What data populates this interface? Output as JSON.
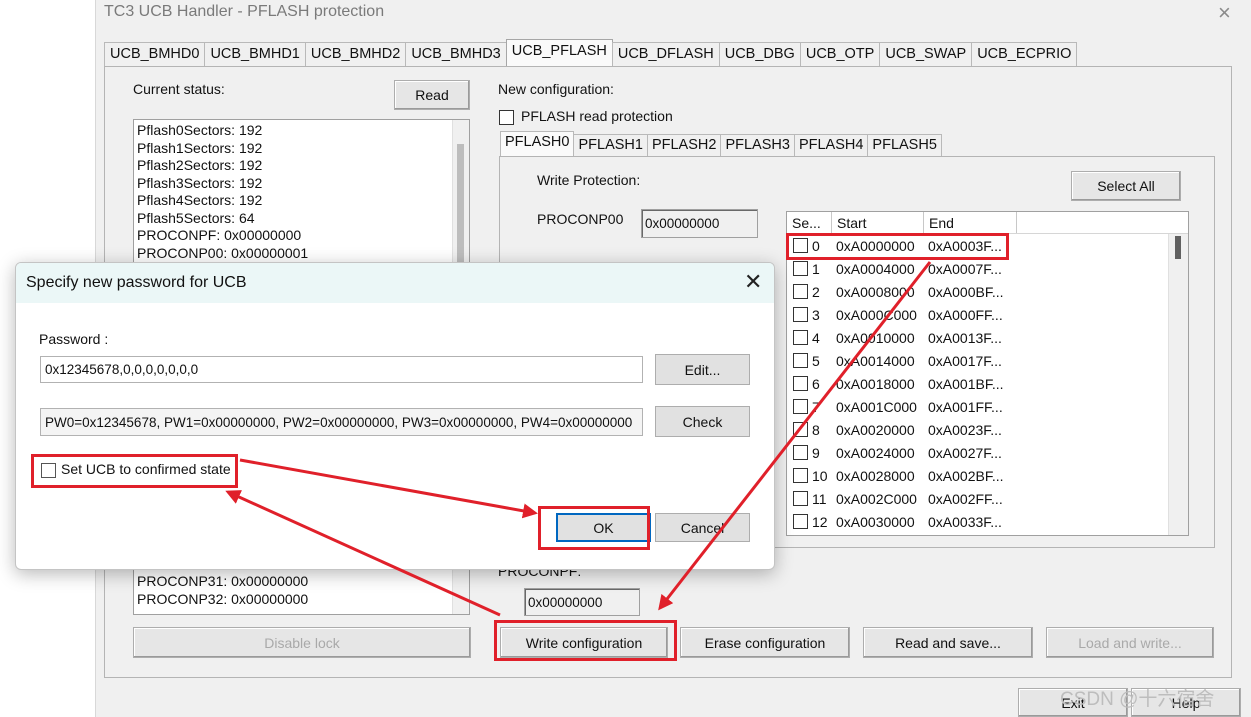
{
  "window": {
    "title": "TC3 UCB Handler - PFLASH protection",
    "close_glyph": "×"
  },
  "tabs": [
    "UCB_BMHD0",
    "UCB_BMHD1",
    "UCB_BMHD2",
    "UCB_BMHD3",
    "UCB_PFLASH",
    "UCB_DFLASH",
    "UCB_DBG",
    "UCB_OTP",
    "UCB_SWAP",
    "UCB_ECPRIO"
  ],
  "selected_tab": "UCB_PFLASH",
  "current_status": {
    "label": "Current status:",
    "read_button": "Read",
    "lines_top": [
      "Pflash0Sectors: 192",
      "Pflash1Sectors: 192",
      "Pflash2Sectors: 192",
      "Pflash3Sectors: 192",
      "Pflash4Sectors: 192",
      "Pflash5Sectors: 64",
      "PROCONPF: 0x00000000",
      "PROCONP00: 0x00000001"
    ],
    "lines_bottom": [
      "PROCONP31: 0x00000000",
      "PROCONP32: 0x00000000"
    ],
    "disable_lock_button": "Disable lock"
  },
  "new_config": {
    "label": "New configuration:",
    "read_protection_label": "PFLASH read protection",
    "read_protection_checked": false,
    "subtabs": [
      "PFLASH0",
      "PFLASH1",
      "PFLASH2",
      "PFLASH3",
      "PFLASH4",
      "PFLASH5"
    ],
    "selected_subtab": "PFLASH0",
    "write_protection_label": "Write Protection:",
    "select_all_button": "Select All",
    "proconp00_label": "PROCONP00",
    "proconp00_value": "0x00000000",
    "proconpf_label": "PROCONPF:",
    "proconpf_value": "0x00000000",
    "columns": [
      "Se...",
      "Start",
      "End"
    ],
    "sectors": [
      {
        "num": "0",
        "start": "0xA0000000",
        "end": "0xA0003F..."
      },
      {
        "num": "1",
        "start": "0xA0004000",
        "end": "0xA0007F..."
      },
      {
        "num": "2",
        "start": "0xA0008000",
        "end": "0xA000BF..."
      },
      {
        "num": "3",
        "start": "0xA000C000",
        "end": "0xA000FF..."
      },
      {
        "num": "4",
        "start": "0xA0010000",
        "end": "0xA0013F..."
      },
      {
        "num": "5",
        "start": "0xA0014000",
        "end": "0xA0017F..."
      },
      {
        "num": "6",
        "start": "0xA0018000",
        "end": "0xA001BF..."
      },
      {
        "num": "7",
        "start": "0xA001C000",
        "end": "0xA001FF..."
      },
      {
        "num": "8",
        "start": "0xA0020000",
        "end": "0xA0023F..."
      },
      {
        "num": "9",
        "start": "0xA0024000",
        "end": "0xA0027F..."
      },
      {
        "num": "10",
        "start": "0xA0028000",
        "end": "0xA002BF..."
      },
      {
        "num": "11",
        "start": "0xA002C000",
        "end": "0xA002FF..."
      },
      {
        "num": "12",
        "start": "0xA0030000",
        "end": "0xA0033F..."
      }
    ]
  },
  "bottom_buttons": {
    "write_config": "Write configuration",
    "erase_config": "Erase configuration",
    "read_and_save": "Read and save...",
    "load_and_write": "Load and write...",
    "exit": "Exit",
    "help": "Help"
  },
  "dialog": {
    "title": "Specify new password for UCB",
    "close_glyph": "✕",
    "password_label": "Password :",
    "password_value": "0x12345678,0,0,0,0,0,0,0",
    "edit_button": "Edit...",
    "summary_value": "PW0=0x12345678, PW1=0x00000000, PW2=0x00000000, PW3=0x00000000, PW4=0x00000000",
    "check_button": "Check",
    "confirmed_label": "Set UCB to confirmed state",
    "confirmed_checked": false,
    "ok_button": "OK",
    "cancel_button": "Cancel"
  },
  "watermark": "CSDN @十六宿舍",
  "colors": {
    "annotation": "#e0202a",
    "dialog_header": "#ebf7f7"
  }
}
